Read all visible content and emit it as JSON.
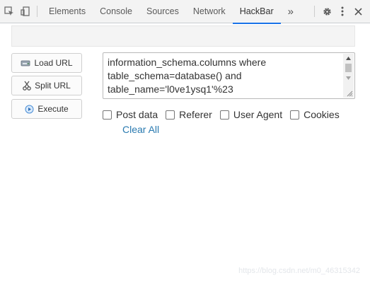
{
  "devtools": {
    "tabs": [
      {
        "label": "Elements"
      },
      {
        "label": "Console"
      },
      {
        "label": "Sources"
      },
      {
        "label": "Network"
      },
      {
        "label": "HackBar"
      }
    ],
    "active_tab": "HackBar",
    "more_tabs_label": "»",
    "accent_color": "#1a73e8"
  },
  "hackbar": {
    "url_value": "",
    "buttons": {
      "load": "Load URL",
      "split": "Split URL",
      "execute": "Execute"
    },
    "textarea_lines": [
      "information_schema.columns where",
      "table_schema=database() and",
      "table_name='l0ve1ysq1'%23"
    ],
    "options": [
      {
        "label": "Post data",
        "checked": false
      },
      {
        "label": "Referer",
        "checked": false
      },
      {
        "label": "User Agent",
        "checked": false
      },
      {
        "label": "Cookies",
        "checked": false
      }
    ],
    "clear_all": "Clear All"
  },
  "watermark": "https://blog.csdn.net/m0_46315342"
}
